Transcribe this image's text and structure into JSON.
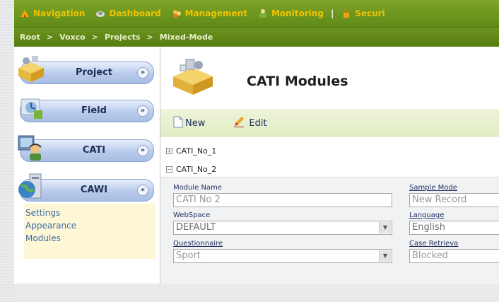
{
  "nav": {
    "items": [
      {
        "label": "Navigation",
        "icon": "navigation-icon"
      },
      {
        "label": "Dashboard",
        "icon": "dashboard-icon"
      },
      {
        "label": "Management",
        "icon": "management-icon"
      },
      {
        "label": "Monitoring",
        "icon": "monitoring-icon"
      }
    ],
    "separator": "|",
    "security_label": "Securi",
    "security_icon": "lock-icon"
  },
  "breadcrumb": {
    "items": [
      "Root",
      "Voxco",
      "Projects",
      "Mixed-Mode"
    ],
    "separator": ">"
  },
  "sidebar": {
    "items": [
      {
        "label": "Project",
        "icon": "project-icon",
        "state": "collapsed",
        "chevron": "»"
      },
      {
        "label": "Field",
        "icon": "field-icon",
        "state": "collapsed",
        "chevron": "»"
      },
      {
        "label": "CATI",
        "icon": "cati-icon",
        "state": "collapsed",
        "chevron": "»"
      },
      {
        "label": "CAWI",
        "icon": "cawi-icon",
        "state": "expanded",
        "chevron": "«"
      }
    ],
    "submenu": [
      "Settings",
      "Appearance",
      "Modules"
    ]
  },
  "page": {
    "title": "CATI Modules",
    "icon": "modules-box-icon"
  },
  "toolbar": {
    "new_label": "New",
    "edit_label": "Edit"
  },
  "tree": {
    "rows": [
      {
        "label": "CATI_No_1",
        "toggle": "+"
      },
      {
        "label": "CATI_No_2",
        "toggle": "−"
      }
    ]
  },
  "form": {
    "module_name_label": "Module Name",
    "module_name_value": "CATI No 2",
    "sample_mode_label": "Sample Mode",
    "sample_mode_value": "New Record",
    "webspace_label": "WebSpace",
    "webspace_value": "DEFAULT",
    "language_label": "Language",
    "language_value": "English",
    "questionnaire_label": "Questionnaire",
    "questionnaire_value": "Sport",
    "case_retrieval_label": "Case Retrieva",
    "case_retrieval_value": "Blocked"
  },
  "colors": {
    "nav_green": "#6c931f",
    "nav_text": "#f0c400",
    "sidebar_button": "#b9cbec",
    "submenu_bg": "#fdf7d6",
    "toolbar_bg": "#e7efcc"
  }
}
